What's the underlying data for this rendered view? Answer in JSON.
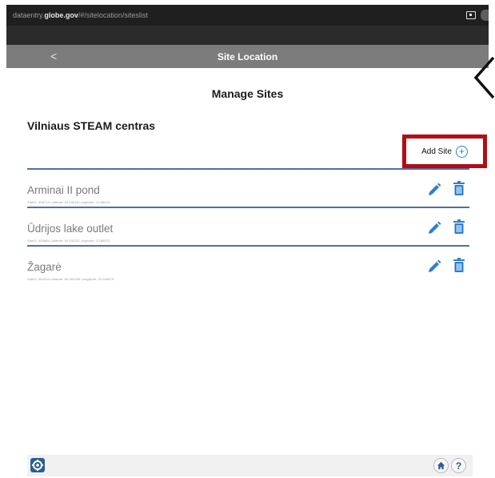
{
  "browser": {
    "url_prefix": "dataentry.",
    "url_domain": "globe.gov",
    "url_path": "/#/sitelocation/siteslist"
  },
  "header": {
    "back_label": "<",
    "title": "Site Location"
  },
  "page": {
    "title": "Manage Sites",
    "organization": "Vilniaus STEAM centras"
  },
  "actions": {
    "add_site_label": "Add Site",
    "add_icon": "+"
  },
  "sites": [
    {
      "name": "Arminai II pond",
      "meta": "SiteID: 405713   Latitude: 54.43225   Longitude: 23.88913"
    },
    {
      "name": "Ūdrijos lake outlet",
      "meta": "SiteID: 405684   Latitude: 54.43325   Longitude: 23.86023"
    },
    {
      "name": "Žagarė",
      "meta": "SiteID: 364104   Latitude: 56.362069   Longitude: 23.264879"
    }
  ],
  "footer": {
    "help_label": "?"
  },
  "colors": {
    "header_bg": "#7c7c7c",
    "accent_blue": "#2f7fcf",
    "divider_blue": "#4f6fa5",
    "highlight_red": "#b40c14",
    "settings_blue": "#2a5f93"
  }
}
